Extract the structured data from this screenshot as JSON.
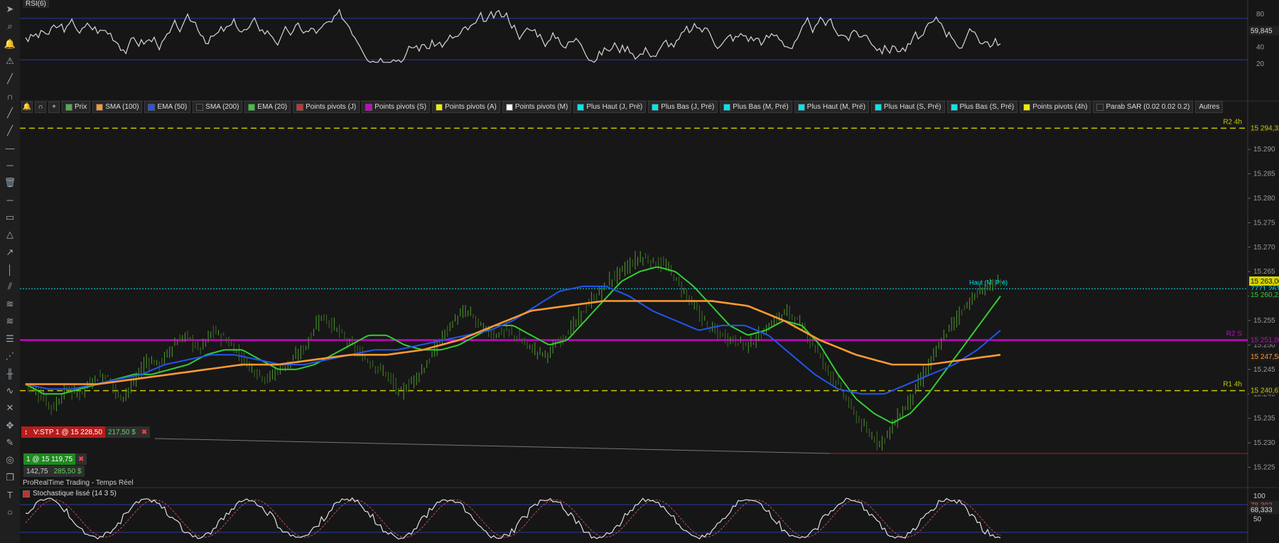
{
  "toolbar_icons": [
    "cursor-icon",
    "magnifier-icon",
    "bell-icon",
    "alert-icon",
    "line-icon",
    "magnet-icon",
    "red-line-icon",
    "trend-line-icon",
    "green-line-icon",
    "hline-icon",
    "trash-icon",
    "red-hline-icon",
    "rectangle-icon",
    "triangle-icon",
    "arrow-icon",
    "vline-icon",
    "channel-icon",
    "fibonacci-icon",
    "fib-fan-icon",
    "fib-retracement-icon",
    "gann-icon",
    "fib-time-icon",
    "wave-icon",
    "tools-icon",
    "move-icon",
    "pen-icon",
    "spiral-icon",
    "copy-icon",
    "text-icon",
    "circle-icon"
  ],
  "rsi": {
    "label": "RSI(6)",
    "value_label": "59,845",
    "ticks": [
      {
        "v": 80,
        "label": "80"
      },
      {
        "v": 40,
        "label": "40"
      },
      {
        "v": 20,
        "label": "20"
      }
    ],
    "levels": [
      75,
      25
    ]
  },
  "legend": {
    "items": [
      {
        "label": "Prix",
        "color": "#4caf50"
      },
      {
        "label": "SMA (100)",
        "color": "#ff9933"
      },
      {
        "label": "EMA (50)",
        "color": "#2255ee"
      },
      {
        "label": "SMA (200)",
        "color": "#222222"
      },
      {
        "label": "EMA (20)",
        "color": "#33cc33"
      },
      {
        "label": "Points pivots (J)",
        "color": "#cc3333"
      },
      {
        "label": "Points pivots (S)",
        "color": "#cc00cc"
      },
      {
        "label": "Points pivots (A)",
        "color": "#eeee00"
      },
      {
        "label": "Points pivots (M)",
        "color": "#ffffff"
      },
      {
        "label": "Plus Haut (J, Pré)",
        "color": "#00e5ee"
      },
      {
        "label": "Plus Bas (J, Pré)",
        "color": "#00e5ee"
      },
      {
        "label": "Plus Bas (M, Pré)",
        "color": "#00e5ee"
      },
      {
        "label": "Plus Haut (M, Pré)",
        "color": "#00e5ee"
      },
      {
        "label": "Plus Haut (S, Pré)",
        "color": "#00e5ee"
      },
      {
        "label": "Plus Bas (S, Pré)",
        "color": "#00e5ee"
      },
      {
        "label": "Points pivots (4h)",
        "color": "#eeee00"
      },
      {
        "label": "Parab SAR (0.02 0.02 0.2)",
        "color": "#222222"
      },
      {
        "label": "Autres",
        "color": ""
      }
    ]
  },
  "orders": {
    "stop": {
      "label": "V:STP  1 @ 15 228,50",
      "pl": "217,50 $"
    },
    "position": {
      "label": "1 @ 15 119,75",
      "pts": "142,75",
      "pl": "285,50 $"
    }
  },
  "footer_title": "ProRealTime Trading - Temps Réel",
  "stoch": {
    "label": "Stochastique lissé (14 3 5)",
    "ticks": [
      {
        "v": 100,
        "label": "100"
      },
      {
        "v": 50,
        "label": "50"
      }
    ],
    "levels": [
      80,
      20
    ],
    "value_a": "78,302",
    "value_b": "68,333"
  },
  "chart_data": {
    "type": "line",
    "title": "",
    "xlabel": "",
    "ylabel": "",
    "ylim": [
      15221,
      15297
    ],
    "yticks": [
      15225,
      15230,
      15235,
      15240,
      15245,
      15250,
      15255,
      15260,
      15265,
      15270,
      15275,
      15280,
      15285,
      15290
    ],
    "ytick_labels": [
      "15.225",
      "15.230",
      "15.235",
      "15.240",
      "15.245",
      "15.250",
      "15.255",
      "15.260",
      "15.265",
      "15.270",
      "15.275",
      "15.280",
      "15.285",
      "15.290"
    ],
    "price_anchors": [
      15242,
      15240,
      15237,
      15241,
      15240,
      15243,
      15244,
      15239,
      15242,
      15247,
      15246,
      15250,
      15252,
      15249,
      15253,
      15251,
      15248,
      15245,
      15243,
      15245,
      15247,
      15250,
      15256,
      15254,
      15251,
      15248,
      15246,
      15244,
      15240,
      15243,
      15246,
      15251,
      15255,
      15257,
      15254,
      15252,
      15253,
      15251,
      15249,
      15248,
      15251,
      15254,
      15258,
      15261,
      15264,
      15266,
      15268,
      15267,
      15266,
      15262,
      15258,
      15254,
      15252,
      15251,
      15250,
      15252,
      15255,
      15257,
      15254,
      15250,
      15245,
      15241,
      15236,
      15232,
      15230,
      15234,
      15238,
      15243,
      15248,
      15253,
      15257,
      15260,
      15262,
      15263
    ],
    "series": [
      {
        "name": "EMA (20)",
        "color": "#33cc33",
        "anchors": [
          15242,
          15240,
          15240,
          15241,
          15242,
          15243,
          15244,
          15244,
          15245,
          15246,
          15248,
          15249,
          15249,
          15247,
          15245,
          15245,
          15246,
          15248,
          15250,
          15252,
          15252,
          15250,
          15249,
          15249,
          15250,
          15252,
          15254,
          15254,
          15252,
          15250,
          15251,
          15255,
          15259,
          15263,
          15265,
          15266,
          15265,
          15262,
          15258,
          15254,
          15252,
          15253,
          15255,
          15254,
          15250,
          15244,
          15239,
          15236,
          15234,
          15236,
          15240,
          15245,
          15250,
          15255,
          15260
        ]
      },
      {
        "name": "EMA (50)",
        "color": "#2255ee",
        "anchors": [
          15242,
          15241,
          15241,
          15242,
          15243,
          15244,
          15246,
          15247,
          15248,
          15248,
          15247,
          15246,
          15246,
          15247,
          15248,
          15249,
          15249,
          15250,
          15251,
          15252,
          15253,
          15255,
          15258,
          15261,
          15262,
          15262,
          15260,
          15257,
          15255,
          15253,
          15254,
          15254,
          15252,
          15248,
          15244,
          15241,
          15240,
          15240,
          15242,
          15244,
          15246,
          15249,
          15253
        ]
      },
      {
        "name": "SMA (100)",
        "color": "#ff9933",
        "anchors": [
          15242,
          15242,
          15242,
          15243,
          15244,
          15245,
          15246,
          15246,
          15247,
          15248,
          15248,
          15249,
          15251,
          15254,
          15257,
          15258,
          15259,
          15259,
          15259,
          15259,
          15258,
          15255,
          15251,
          15248,
          15246,
          15246,
          15247,
          15248
        ]
      }
    ],
    "hlines": [
      {
        "value": 15294.33,
        "label": "R2 4h",
        "axis_label": "15 294,33",
        "color": "#c8c800"
      },
      {
        "value": 15251.0,
        "label": "R2 S",
        "axis_label": "15 251,00",
        "color": "#cc00cc"
      },
      {
        "value": 15240.67,
        "label": "R1 4h",
        "axis_label": "15 240,67",
        "color": "#c8c800"
      },
      {
        "value": 15261.5,
        "label": "Haut (M, Pré)",
        "axis_label": "7771 261,50",
        "color": "#00e5ee"
      }
    ],
    "axis_value_labels": [
      {
        "value": 15263.0,
        "label": "15 263,00",
        "color": "#d4d400"
      },
      {
        "value": 15260.22,
        "label": "15 260,22",
        "color": "#33cc33"
      },
      {
        "value": 15247.58,
        "label": "15 247,58",
        "color": "#ff9933"
      }
    ]
  }
}
